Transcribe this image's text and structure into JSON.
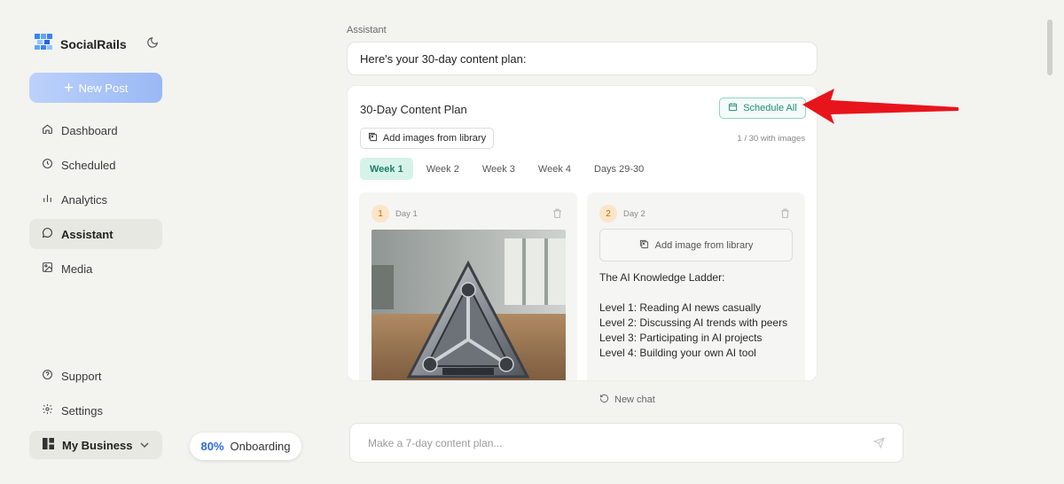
{
  "app": {
    "name": "SocialRails",
    "new_post_label": "New Post"
  },
  "nav": [
    {
      "label": "Dashboard",
      "icon": "home-icon"
    },
    {
      "label": "Scheduled",
      "icon": "clock-icon"
    },
    {
      "label": "Analytics",
      "icon": "bar-chart-icon"
    },
    {
      "label": "Assistant",
      "icon": "chat-bubble-icon",
      "active": true
    },
    {
      "label": "Media",
      "icon": "image-icon"
    }
  ],
  "bottom_nav": [
    {
      "label": "Support",
      "icon": "help-circle-icon"
    },
    {
      "label": "Settings",
      "icon": "gear-icon"
    }
  ],
  "business": {
    "label": "My Business"
  },
  "onboarding": {
    "percent": "80%",
    "label": "Onboarding"
  },
  "chat": {
    "role_label": "Assistant",
    "message": "Here's your 30-day content plan:"
  },
  "plan": {
    "title": "30-Day Content Plan",
    "schedule_all_label": "Schedule All",
    "add_images_label": "Add images from library",
    "image_count": "1 / 30 with images",
    "tabs": [
      "Week 1",
      "Week 2",
      "Week 3",
      "Week 4",
      "Days 29-30"
    ],
    "active_tab": 0,
    "days": [
      {
        "number": "1",
        "label": "Day 1",
        "has_image": true
      },
      {
        "number": "2",
        "label": "Day 2",
        "add_image_label": "Add image from library",
        "text": "The AI Knowledge Ladder:\n\nLevel 1: Reading AI news casually\nLevel 2: Discussing AI trends with peers\nLevel 3: Participating in AI projects\nLevel 4: Building your own AI tool"
      }
    ]
  },
  "new_chat_label": "New chat",
  "composer": {
    "placeholder": "Make a 7-day content plan..."
  },
  "colors": {
    "accent_blue": "#2d6cdf",
    "accent_green": "#1f8f6f",
    "annotation_red": "#e8141b"
  }
}
